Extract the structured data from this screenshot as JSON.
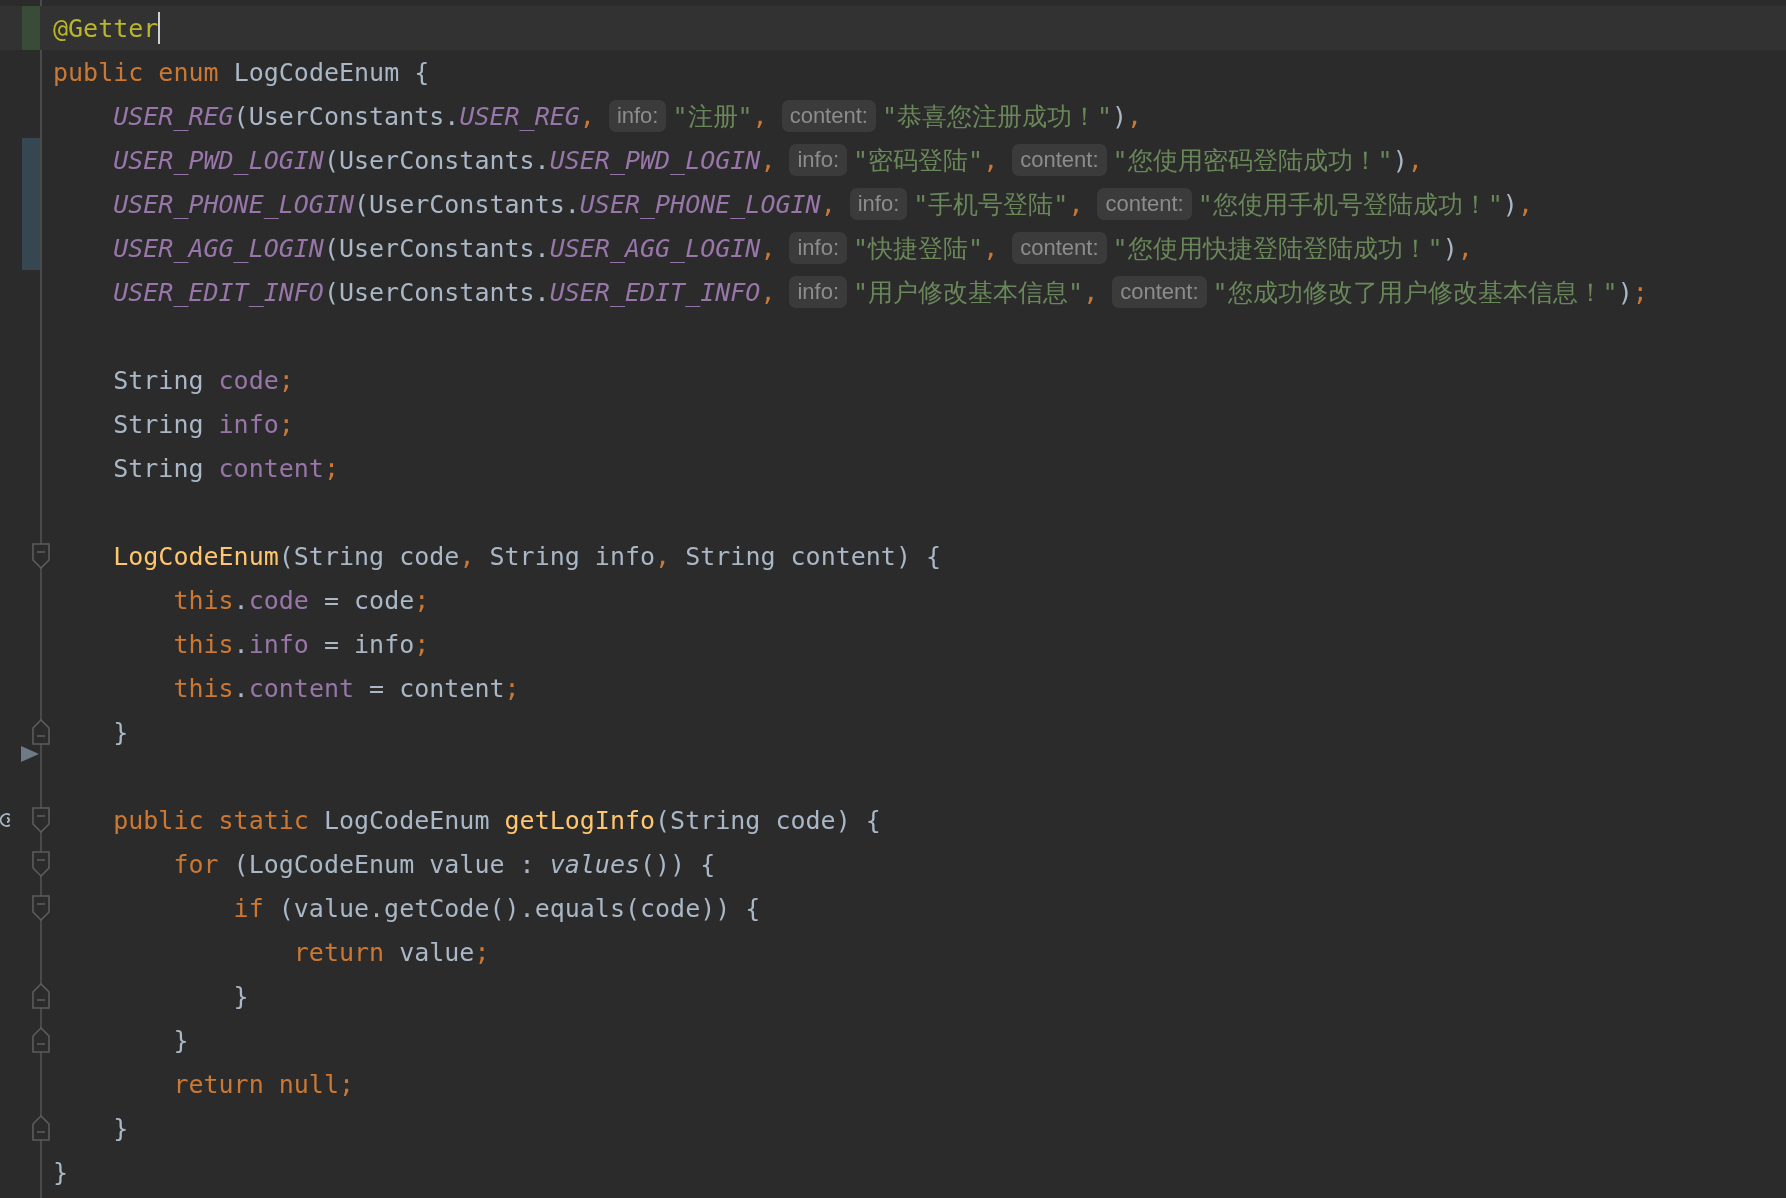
{
  "editor": {
    "lines": [
      {
        "kind": "code",
        "current": true,
        "added": true,
        "cursor": true,
        "segments": [
          {
            "kind": "code",
            "tokens": [
              {
                "t": "@Getter",
                "kind": "annotation"
              }
            ]
          }
        ]
      },
      {
        "kind": "code",
        "segments": [
          {
            "kind": "code",
            "tokens": [
              {
                "t": "public enum",
                "kind": "keyword"
              },
              {
                "t": " LogCodeEnum {",
                "kind": "plain"
              }
            ]
          }
        ],
        "children": [
          {
            "kind": "code",
            "segments": [
              {
                "kind": "code",
                "tokens": [
                  {
                    "t": "USER_REG",
                    "kind": "constant"
                  },
                  {
                    "t": "(UserConstants.",
                    "kind": "plain"
                  },
                  {
                    "t": "USER_REG",
                    "kind": "constant"
                  },
                  {
                    "t": ",",
                    "kind": "keyword"
                  }
                ]
              },
              {
                "kind": "hint",
                "text": "info:"
              },
              {
                "kind": "code",
                "tokens": [
                  {
                    "t": "\"注册\"",
                    "kind": "string"
                  },
                  {
                    "t": ",",
                    "kind": "keyword"
                  }
                ]
              },
              {
                "kind": "hint",
                "text": "content:"
              },
              {
                "kind": "code",
                "tokens": [
                  {
                    "t": "\"恭喜您注册成功！\"",
                    "kind": "string"
                  },
                  {
                    "t": ")",
                    "kind": "plain"
                  },
                  {
                    "t": ",",
                    "kind": "keyword"
                  }
                ]
              }
            ]
          },
          {
            "kind": "code",
            "modified": true,
            "segments": [
              {
                "kind": "code",
                "tokens": [
                  {
                    "t": "USER_PWD_LOGIN",
                    "kind": "constant"
                  },
                  {
                    "t": "(UserConstants.",
                    "kind": "plain"
                  },
                  {
                    "t": "USER_PWD_LOGIN",
                    "kind": "constant"
                  },
                  {
                    "t": ",",
                    "kind": "keyword"
                  }
                ]
              },
              {
                "kind": "hint",
                "text": "info:"
              },
              {
                "kind": "code",
                "tokens": [
                  {
                    "t": "\"密码登陆\"",
                    "kind": "string"
                  },
                  {
                    "t": ",",
                    "kind": "keyword"
                  }
                ]
              },
              {
                "kind": "hint",
                "text": "content:"
              },
              {
                "kind": "code",
                "tokens": [
                  {
                    "t": "\"您使用密码登陆成功！\"",
                    "kind": "string"
                  },
                  {
                    "t": ")",
                    "kind": "plain"
                  },
                  {
                    "t": ",",
                    "kind": "keyword"
                  }
                ]
              }
            ]
          },
          {
            "kind": "code",
            "modified": true,
            "segments": [
              {
                "kind": "code",
                "tokens": [
                  {
                    "t": "USER_PHONE_LOGIN",
                    "kind": "constant"
                  },
                  {
                    "t": "(UserConstants.",
                    "kind": "plain"
                  },
                  {
                    "t": "USER_PHONE_LOGIN",
                    "kind": "constant"
                  },
                  {
                    "t": ",",
                    "kind": "keyword"
                  }
                ]
              },
              {
                "kind": "hint",
                "text": "info:"
              },
              {
                "kind": "code",
                "tokens": [
                  {
                    "t": "\"手机号登陆\"",
                    "kind": "string"
                  },
                  {
                    "t": ",",
                    "kind": "keyword"
                  }
                ]
              },
              {
                "kind": "hint",
                "text": "content:"
              },
              {
                "kind": "code",
                "tokens": [
                  {
                    "t": "\"您使用手机号登陆成功！\"",
                    "kind": "string"
                  },
                  {
                    "t": ")",
                    "kind": "plain"
                  },
                  {
                    "t": ",",
                    "kind": "keyword"
                  }
                ]
              }
            ]
          },
          {
            "kind": "code",
            "modified": true,
            "segments": [
              {
                "kind": "code",
                "tokens": [
                  {
                    "t": "USER_AGG_LOGIN",
                    "kind": "constant"
                  },
                  {
                    "t": "(UserConstants.",
                    "kind": "plain"
                  },
                  {
                    "t": "USER_AGG_LOGIN",
                    "kind": "constant"
                  },
                  {
                    "t": ",",
                    "kind": "keyword"
                  }
                ]
              },
              {
                "kind": "hint",
                "text": "info:"
              },
              {
                "kind": "code",
                "tokens": [
                  {
                    "t": "\"快捷登陆\"",
                    "kind": "string"
                  },
                  {
                    "t": ",",
                    "kind": "keyword"
                  }
                ]
              },
              {
                "kind": "hint",
                "text": "content:"
              },
              {
                "kind": "code",
                "tokens": [
                  {
                    "t": "\"您使用快捷登陆登陆成功！\"",
                    "kind": "string"
                  },
                  {
                    "t": ")",
                    "kind": "plain"
                  },
                  {
                    "t": ",",
                    "kind": "keyword"
                  }
                ]
              }
            ]
          },
          {
            "kind": "code",
            "segments": [
              {
                "kind": "code",
                "tokens": [
                  {
                    "t": "USER_EDIT_INFO",
                    "kind": "constant"
                  },
                  {
                    "t": "(UserConstants.",
                    "kind": "plain"
                  },
                  {
                    "t": "USER_EDIT_INFO",
                    "kind": "constant"
                  },
                  {
                    "t": ",",
                    "kind": "keyword"
                  }
                ]
              },
              {
                "kind": "hint",
                "text": "info:"
              },
              {
                "kind": "code",
                "tokens": [
                  {
                    "t": "\"用户修改基本信息\"",
                    "kind": "string"
                  },
                  {
                    "t": ",",
                    "kind": "keyword"
                  }
                ]
              },
              {
                "kind": "hint",
                "text": "content:"
              },
              {
                "kind": "code",
                "tokens": [
                  {
                    "t": "\"您成功修改了用户修改基本信息！\"",
                    "kind": "string"
                  },
                  {
                    "t": ")",
                    "kind": "plain"
                  },
                  {
                    "t": ";",
                    "kind": "keyword"
                  }
                ]
              }
            ]
          },
          {
            "kind": "blank"
          },
          {
            "kind": "code",
            "segments": [
              {
                "kind": "code",
                "tokens": [
                  {
                    "t": "String ",
                    "kind": "plain"
                  },
                  {
                    "t": "code",
                    "kind": "field"
                  },
                  {
                    "t": ";",
                    "kind": "keyword"
                  }
                ]
              }
            ]
          },
          {
            "kind": "code",
            "segments": [
              {
                "kind": "code",
                "tokens": [
                  {
                    "t": "String ",
                    "kind": "plain"
                  },
                  {
                    "t": "info",
                    "kind": "field"
                  },
                  {
                    "t": ";",
                    "kind": "keyword"
                  }
                ]
              }
            ]
          },
          {
            "kind": "code",
            "segments": [
              {
                "kind": "code",
                "tokens": [
                  {
                    "t": "String ",
                    "kind": "plain"
                  },
                  {
                    "t": "content",
                    "kind": "field"
                  },
                  {
                    "t": ";",
                    "kind": "keyword"
                  }
                ]
              }
            ]
          },
          {
            "kind": "blank"
          },
          {
            "kind": "code",
            "fold_start": true,
            "segments": [
              {
                "kind": "code",
                "tokens": [
                  {
                    "t": "LogCodeEnum",
                    "kind": "declaration"
                  },
                  {
                    "t": "(String code",
                    "kind": "plain"
                  },
                  {
                    "t": ",",
                    "kind": "keyword"
                  },
                  {
                    "t": " String info",
                    "kind": "plain"
                  },
                  {
                    "t": ",",
                    "kind": "keyword"
                  },
                  {
                    "t": " String content) {",
                    "kind": "plain"
                  }
                ]
              }
            ],
            "children": [
              {
                "kind": "code",
                "segments": [
                  {
                    "kind": "code",
                    "tokens": [
                      {
                        "t": "this",
                        "kind": "keyword"
                      },
                      {
                        "t": ".",
                        "kind": "plain"
                      },
                      {
                        "t": "code",
                        "kind": "field"
                      },
                      {
                        "t": " = code",
                        "kind": "plain"
                      },
                      {
                        "t": ";",
                        "kind": "keyword"
                      }
                    ]
                  }
                ]
              },
              {
                "kind": "code",
                "segments": [
                  {
                    "kind": "code",
                    "tokens": [
                      {
                        "t": "this",
                        "kind": "keyword"
                      },
                      {
                        "t": ".",
                        "kind": "plain"
                      },
                      {
                        "t": "info",
                        "kind": "field"
                      },
                      {
                        "t": " = info",
                        "kind": "plain"
                      },
                      {
                        "t": ";",
                        "kind": "keyword"
                      }
                    ]
                  }
                ]
              },
              {
                "kind": "code",
                "segments": [
                  {
                    "kind": "code",
                    "tokens": [
                      {
                        "t": "this",
                        "kind": "keyword"
                      },
                      {
                        "t": ".",
                        "kind": "plain"
                      },
                      {
                        "t": "content",
                        "kind": "field"
                      },
                      {
                        "t": " = content",
                        "kind": "plain"
                      },
                      {
                        "t": ";",
                        "kind": "keyword"
                      }
                    ]
                  }
                ]
              }
            ]
          },
          {
            "kind": "code",
            "fold_end": true,
            "segments": [
              {
                "kind": "code",
                "tokens": [
                  {
                    "t": "}",
                    "kind": "plain"
                  }
                ]
              }
            ]
          },
          {
            "kind": "blank",
            "arrow": true
          },
          {
            "kind": "code",
            "fold_start": true,
            "override": true,
            "segments": [
              {
                "kind": "code",
                "tokens": [
                  {
                    "t": "public static",
                    "kind": "keyword"
                  },
                  {
                    "t": " LogCodeEnum ",
                    "kind": "plain"
                  },
                  {
                    "t": "getLogInfo",
                    "kind": "declaration"
                  },
                  {
                    "t": "(String code) {",
                    "kind": "plain"
                  }
                ]
              }
            ],
            "children": [
              {
                "kind": "code",
                "fold_start": true,
                "segments": [
                  {
                    "kind": "code",
                    "tokens": [
                      {
                        "t": "for",
                        "kind": "keyword"
                      },
                      {
                        "t": " (LogCodeEnum value : ",
                        "kind": "plain"
                      },
                      {
                        "t": "values",
                        "kind": "italic"
                      },
                      {
                        "t": "()) {",
                        "kind": "plain"
                      }
                    ]
                  }
                ],
                "children": [
                  {
                    "kind": "code",
                    "fold_start": true,
                    "segments": [
                      {
                        "kind": "code",
                        "tokens": [
                          {
                            "t": "if",
                            "kind": "keyword"
                          },
                          {
                            "t": " (value.getCode().equals(code)) {",
                            "kind": "plain"
                          }
                        ]
                      }
                    ],
                    "children": [
                      {
                        "kind": "code",
                        "segments": [
                          {
                            "kind": "code",
                            "tokens": [
                              {
                                "t": "return",
                                "kind": "keyword"
                              },
                              {
                                "t": " value",
                                "kind": "plain"
                              },
                              {
                                "t": ";",
                                "kind": "keyword"
                              }
                            ]
                          }
                        ]
                      }
                    ]
                  },
                  {
                    "kind": "code",
                    "fold_end": true,
                    "segments": [
                      {
                        "kind": "code",
                        "tokens": [
                          {
                            "t": "}",
                            "kind": "plain"
                          }
                        ]
                      }
                    ]
                  }
                ]
              },
              {
                "kind": "code",
                "fold_end": true,
                "segments": [
                  {
                    "kind": "code",
                    "tokens": [
                      {
                        "t": "}",
                        "kind": "plain"
                      }
                    ]
                  }
                ]
              },
              {
                "kind": "code",
                "segments": [
                  {
                    "kind": "code",
                    "tokens": [
                      {
                        "t": "return null;",
                        "kind": "keyword"
                      }
                    ]
                  }
                ]
              }
            ]
          },
          {
            "kind": "code",
            "fold_end": true,
            "segments": [
              {
                "kind": "code",
                "tokens": [
                  {
                    "t": "}",
                    "kind": "plain"
                  }
                ]
              }
            ]
          }
        ]
      },
      {
        "kind": "code",
        "segments": [
          {
            "kind": "code",
            "tokens": [
              {
                "t": "}",
                "kind": "plain"
              }
            ]
          }
        ]
      }
    ]
  }
}
